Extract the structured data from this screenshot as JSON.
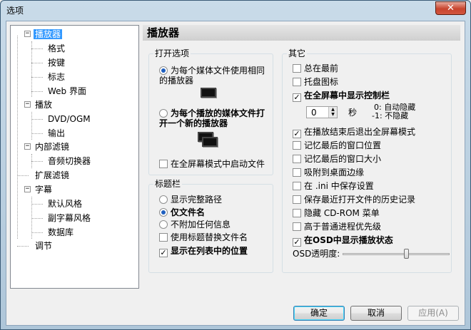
{
  "window": {
    "title": "选项",
    "close_glyph": "✕"
  },
  "tree": {
    "items": [
      {
        "label": "播放器",
        "selected": true
      },
      {
        "label": "格式"
      },
      {
        "label": "按键"
      },
      {
        "label": "标志"
      },
      {
        "label": "Web 界面"
      },
      {
        "label": "播放"
      },
      {
        "label": "DVD/OGM"
      },
      {
        "label": "输出"
      },
      {
        "label": "内部滤镜"
      },
      {
        "label": "音频切换器"
      },
      {
        "label": "扩展滤镜"
      },
      {
        "label": "字幕"
      },
      {
        "label": "默认风格"
      },
      {
        "label": "副字幕风格"
      },
      {
        "label": "数据库"
      },
      {
        "label": "调节"
      }
    ],
    "expander": "−"
  },
  "panel": {
    "title": "播放器"
  },
  "open_options": {
    "title": "打开选项",
    "radio1": "为每个媒体文件使用相同的播放器",
    "radio2": "为每个播放的媒体文件打开一个新的播放器",
    "fullscreen": "在全屏幕模式中启动文件"
  },
  "titlebar_group": {
    "title": "标题栏",
    "r_full": "显示完整路径",
    "r_name": "仅文件名",
    "r_none": "不附加任何信息",
    "cb_replace": "使用标题替换文件名",
    "cb_pos": "显示在列表中的位置"
  },
  "other": {
    "title": "其它",
    "always_top": "总在最前",
    "tray": "托盘图标",
    "show_ctrl": "在全屏幕中显示控制栏",
    "spin_value": "0",
    "seconds": "秒",
    "note1": "0: 自动隐藏",
    "note2": "-1: 不隐藏",
    "exit_fs": "在播放结束后退出全屏幕模式",
    "remember_pos": "记忆最后的窗口位置",
    "remember_size": "记忆最后的窗口大小",
    "snap": "吸附到桌面边缘",
    "ini": "在 .ini 中保存设置",
    "history": "保存最近打开文件的历史记录",
    "cdrom": "隐藏 CD-ROM 菜单",
    "priority": "高于普通进程优先级",
    "osd": "在OSD中显示播放状态",
    "osd_alpha": "OSD透明度:",
    "osd_alpha_level": 0.6
  },
  "buttons": {
    "ok": "确定",
    "cancel": "取消",
    "apply": "应用(A)"
  },
  "check_mark": "✓"
}
